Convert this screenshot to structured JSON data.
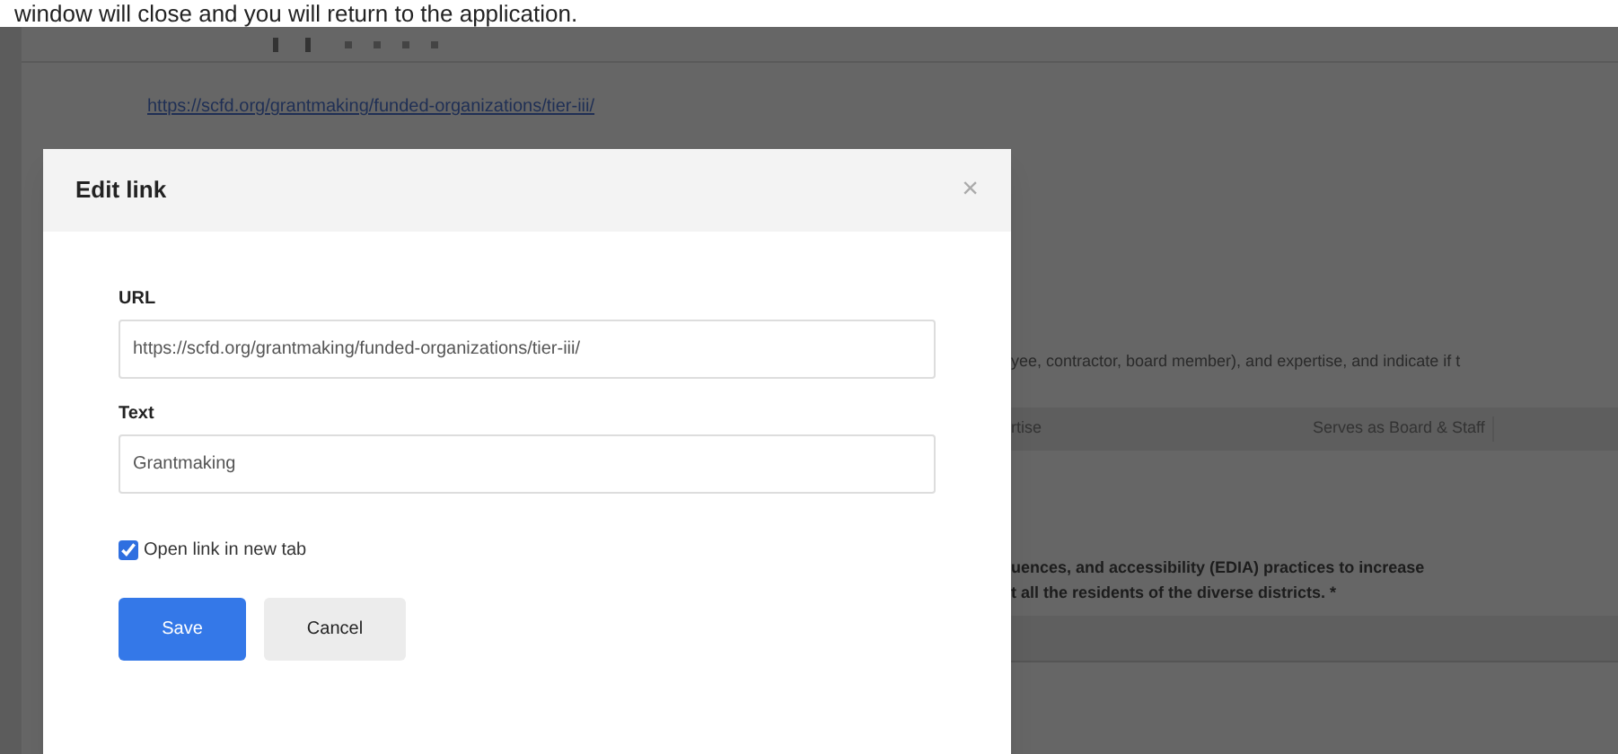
{
  "caption": "window will close and you will return to the application.",
  "background": {
    "link": "https://scfd.org/grantmaking/funded-organizations/tier-iii/",
    "question_line": "yee, contractor, board member), and expertise, and indicate if t",
    "table_columns": [
      "rtise",
      "Serves as Board & Staff"
    ],
    "bold_lines": [
      "uences, and accessibility (EDIA) practices to increase",
      "t all the residents of the diverse districts. *"
    ]
  },
  "dialog": {
    "title": "Edit link",
    "close": "×",
    "fields": [
      {
        "label": "URL",
        "value": "https://scfd.org/grantmaking/funded-organizations/tier-iii/"
      },
      {
        "label": "Text",
        "value": "Grantmaking"
      }
    ],
    "checkbox": {
      "label": "Open link in new tab",
      "checked": true
    },
    "buttons": [
      {
        "label": "Save",
        "kind": "primary"
      },
      {
        "label": "Cancel",
        "kind": "secondary"
      }
    ]
  }
}
